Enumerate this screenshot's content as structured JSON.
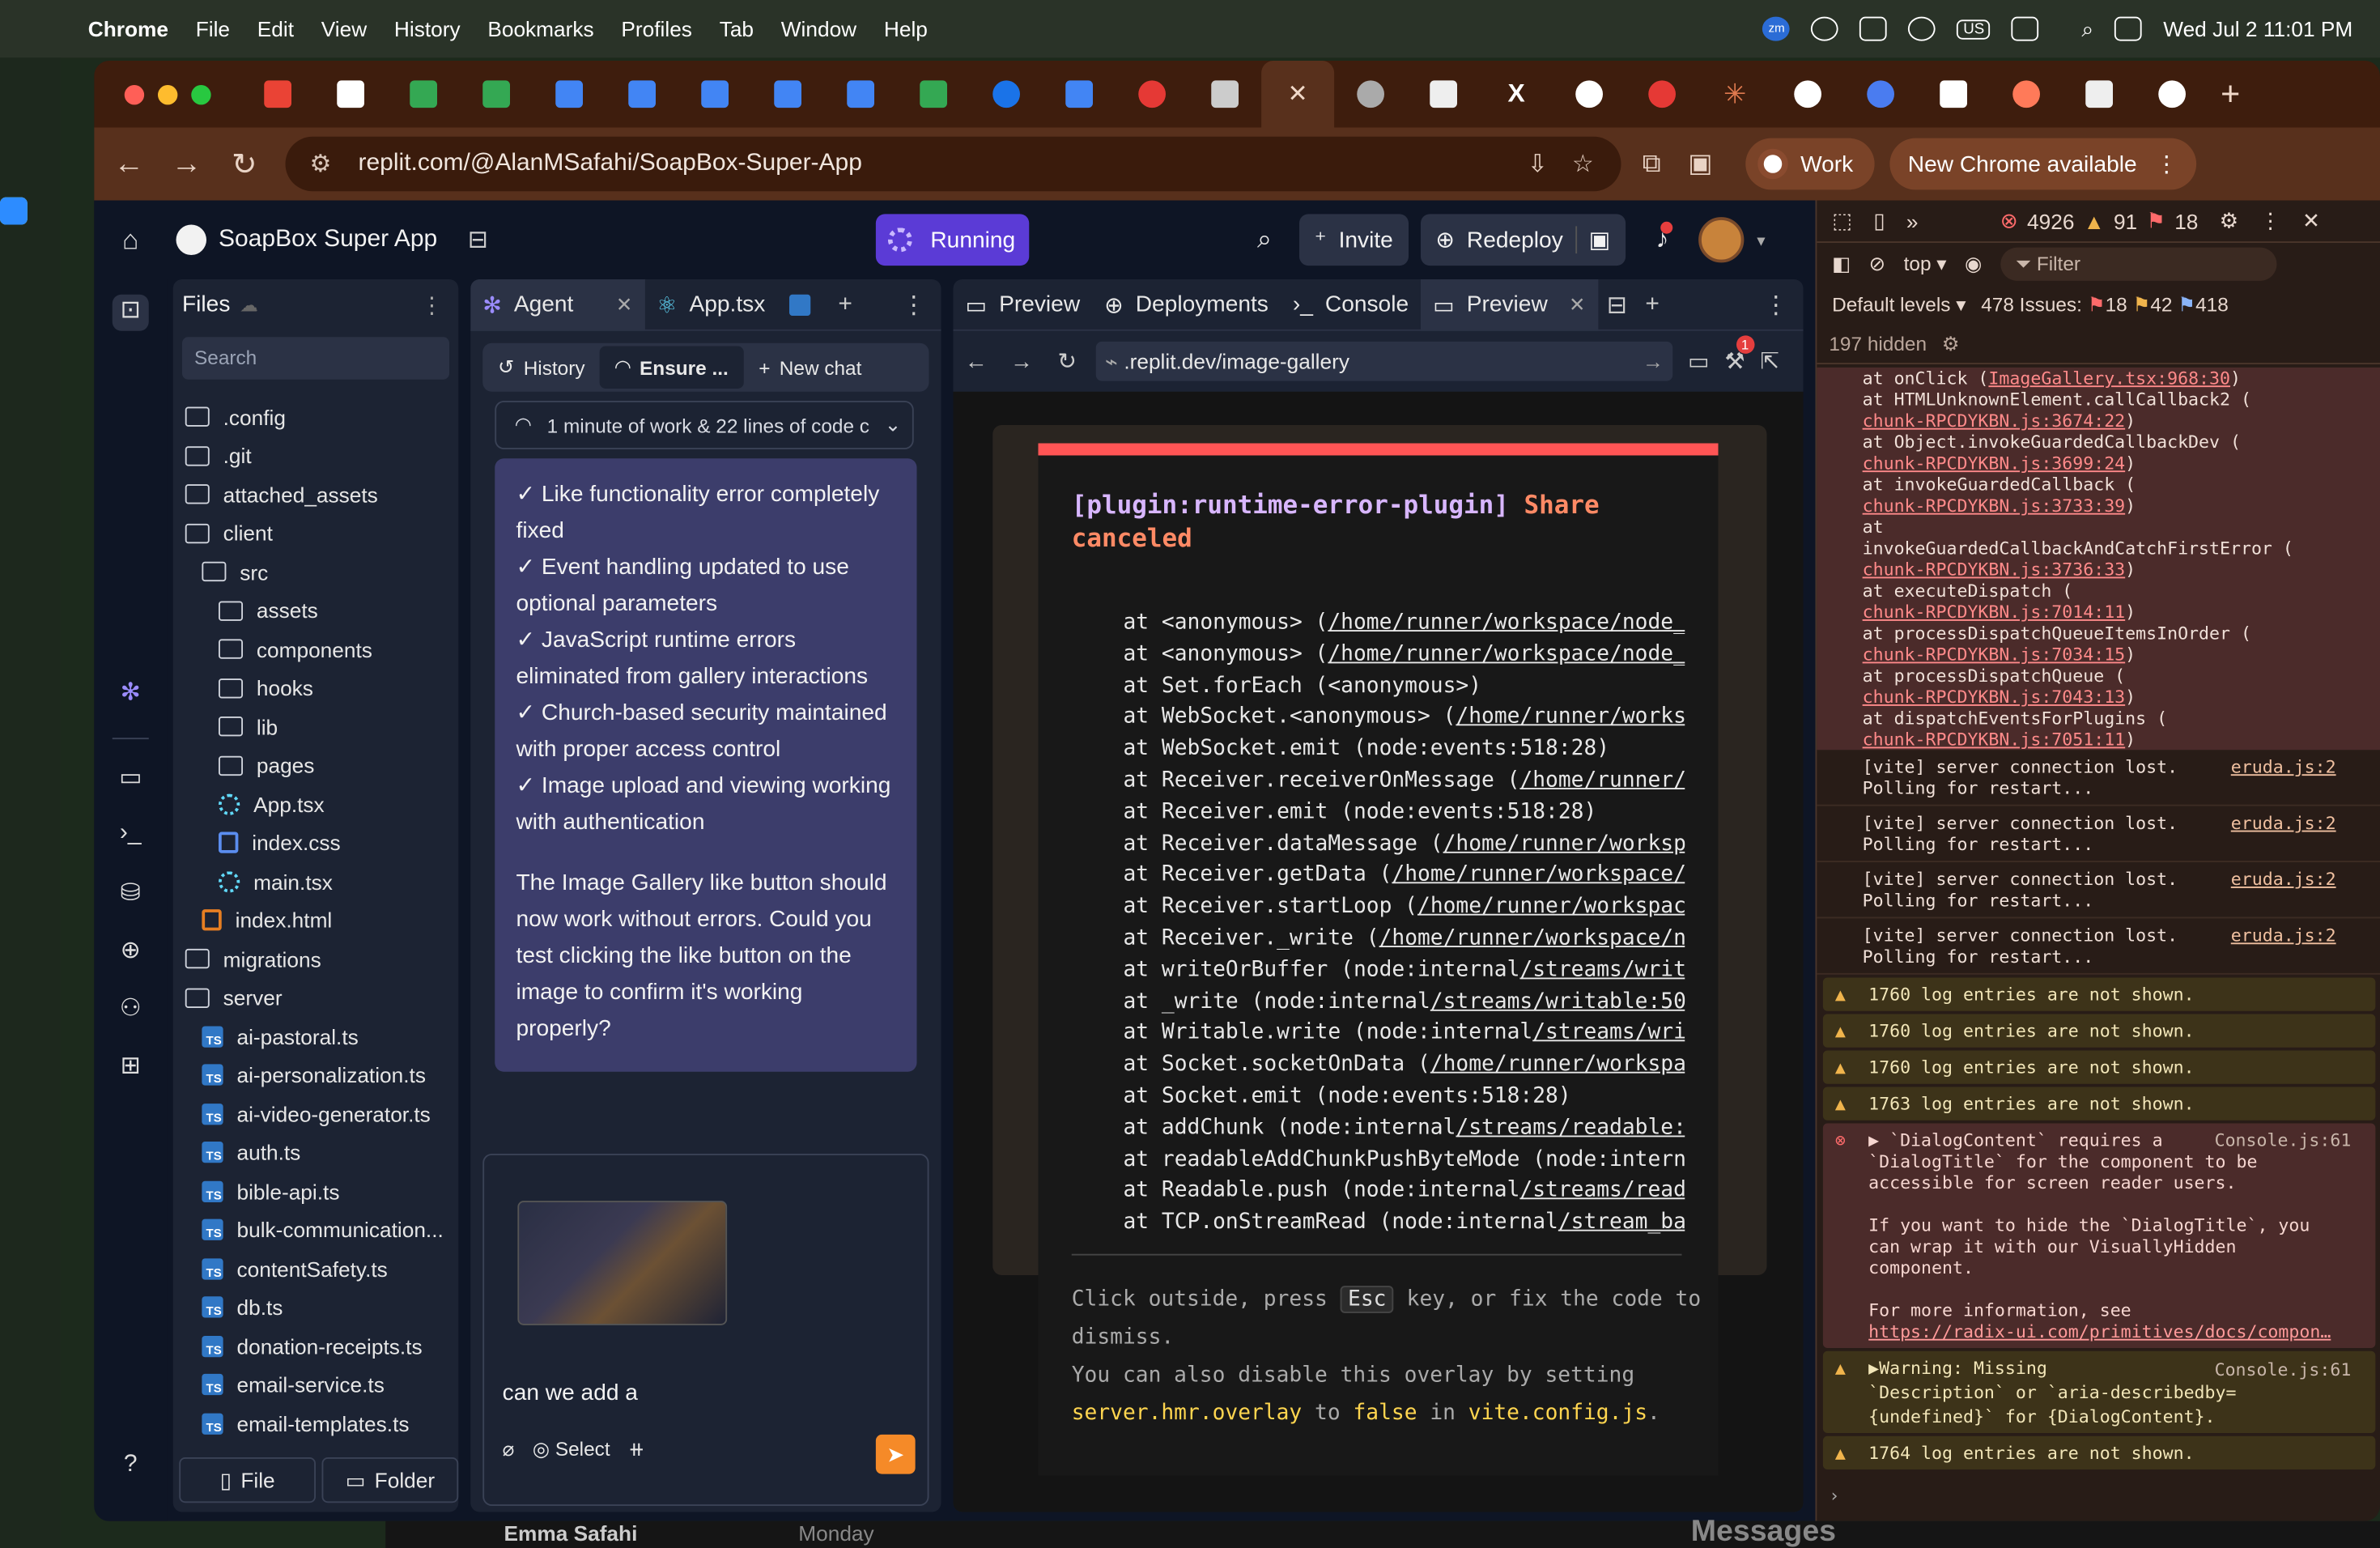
{
  "menubar": {
    "app": "Chrome",
    "items": [
      "File",
      "Edit",
      "View",
      "History",
      "Bookmarks",
      "Profiles",
      "Tab",
      "Window",
      "Help"
    ],
    "status": {
      "keyboard": "US",
      "datetime": "Wed Jul 2  11:01 PM",
      "zoom_icon_label": "zm"
    }
  },
  "browser": {
    "url": "replit.com/@AlanMSafahi/SoapBox-Super-App",
    "profile_label": "Work",
    "update_label": "New Chrome available"
  },
  "replit": {
    "project_name": "SoapBox Super App",
    "run_status": "Running",
    "invite_label": "Invite",
    "redeploy_label": "Redeploy"
  },
  "files": {
    "title": "Files",
    "search_placeholder": "Search",
    "tree": [
      {
        "name": ".config",
        "type": "folder",
        "depth": 0
      },
      {
        "name": ".git",
        "type": "folder",
        "depth": 0
      },
      {
        "name": "attached_assets",
        "type": "folder",
        "depth": 0
      },
      {
        "name": "client",
        "type": "folder",
        "depth": 0
      },
      {
        "name": "src",
        "type": "folder",
        "depth": 1
      },
      {
        "name": "assets",
        "type": "folder",
        "depth": 2
      },
      {
        "name": "components",
        "type": "folder",
        "depth": 2
      },
      {
        "name": "hooks",
        "type": "folder",
        "depth": 2
      },
      {
        "name": "lib",
        "type": "folder",
        "depth": 2
      },
      {
        "name": "pages",
        "type": "folder",
        "depth": 2
      },
      {
        "name": "App.tsx",
        "type": "react",
        "depth": 2
      },
      {
        "name": "index.css",
        "type": "css",
        "depth": 2
      },
      {
        "name": "main.tsx",
        "type": "react",
        "depth": 2
      },
      {
        "name": "index.html",
        "type": "html",
        "depth": 1
      },
      {
        "name": "migrations",
        "type": "folder",
        "depth": 0
      },
      {
        "name": "server",
        "type": "folder",
        "depth": 0
      },
      {
        "name": "ai-pastoral.ts",
        "type": "ts",
        "depth": 1
      },
      {
        "name": "ai-personalization.ts",
        "type": "ts",
        "depth": 1
      },
      {
        "name": "ai-video-generator.ts",
        "type": "ts",
        "depth": 1
      },
      {
        "name": "auth.ts",
        "type": "ts",
        "depth": 1
      },
      {
        "name": "bible-api.ts",
        "type": "ts",
        "depth": 1
      },
      {
        "name": "bulk-communication...",
        "type": "ts",
        "depth": 1
      },
      {
        "name": "contentSafety.ts",
        "type": "ts",
        "depth": 1
      },
      {
        "name": "db.ts",
        "type": "ts",
        "depth": 1
      },
      {
        "name": "donation-receipts.ts",
        "type": "ts",
        "depth": 1
      },
      {
        "name": "email-service.ts",
        "type": "ts",
        "depth": 1
      },
      {
        "name": "email-templates.ts",
        "type": "ts",
        "depth": 1
      }
    ],
    "new_file_label": "File",
    "new_folder_label": "Folder"
  },
  "agent": {
    "tabs": [
      "Agent",
      "App.tsx"
    ],
    "history_label": "History",
    "ensure_label": "Ensure ...",
    "new_chat_label": "New chat",
    "work_summary": "1 minute of work & 22 lines of code c",
    "message_checks": [
      "✓ Like functionality error completely fixed",
      "✓ Event handling updated to use optional parameters",
      "✓ JavaScript runtime errors eliminated from gallery interactions",
      "✓ Church-based security maintained with proper access control",
      "✓ Image upload and viewing working with authentication"
    ],
    "message_followup": "The Image Gallery like button should now work without errors. Could you test clicking the like button on the image to confirm it's working properly?",
    "input_text": "can we add a",
    "select_label": "Select"
  },
  "preview": {
    "tabs": [
      "Preview",
      "Deployments",
      "Console",
      "Preview"
    ],
    "url": ".replit.dev/image-gallery",
    "notification_count": "1",
    "error": {
      "plugin": "[plugin:runtime-error-plugin]",
      "message": "Share canceled",
      "stack": [
        {
          "pre": "at <anonymous> (",
          "link": "/home/runner/workspace/node_m"
        },
        {
          "pre": "at <anonymous> (",
          "link": "/home/runner/workspace/node_m"
        },
        {
          "pre": "at Set.forEach (<anonymous>)",
          "link": ""
        },
        {
          "pre": "at WebSocket.<anonymous> (",
          "link": "/home/runner/works"
        },
        {
          "pre": "at WebSocket.emit (node:events:518:28)",
          "link": ""
        },
        {
          "pre": "at Receiver.receiverOnMessage (",
          "link": "/home/runner/w"
        },
        {
          "pre": "at Receiver.emit (node:events:518:28)",
          "link": ""
        },
        {
          "pre": "at Receiver.dataMessage (",
          "link": "/home/runner/worksp"
        },
        {
          "pre": "at Receiver.getData (",
          "link": "/home/runner/workspace/"
        },
        {
          "pre": "at Receiver.startLoop (",
          "link": "/home/runner/workspac"
        },
        {
          "pre": "at Receiver._write (",
          "link": "/home/runner/workspace/n"
        },
        {
          "pre": "at writeOrBuffer (node:internal",
          "link": "/streams/writa"
        },
        {
          "pre": "at _write (node:internal",
          "link": "/streams/writable:50"
        },
        {
          "pre": "at Writable.write (node:internal",
          "link": "/streams/wri"
        },
        {
          "pre": "at Socket.socketOnData (",
          "link": "/home/runner/workspa"
        },
        {
          "pre": "at Socket.emit (node:events:518:28)",
          "link": ""
        },
        {
          "pre": "at addChunk (node:internal",
          "link": "/streams/readable:5"
        },
        {
          "pre": "at readableAddChunkPushByteMode (node:intern",
          "link": ""
        },
        {
          "pre": "at Readable.push (node:internal",
          "link": "/streams/reada"
        },
        {
          "pre": "at TCP.onStreamRead (node:internal",
          "link": "/stream_ba"
        }
      ],
      "tip_1": "Click outside, press",
      "tip_key": "Esc",
      "tip_2": "key, or fix the code to dismiss.",
      "tip_3": "You can also disable this overlay by setting",
      "tip_code_1": "server.hmr.overlay",
      "tip_4": "to",
      "tip_code_2": "false",
      "tip_5": "in",
      "tip_code_3": "vite.config.js",
      "tip_6": "."
    }
  },
  "devtools": {
    "errors": "4926",
    "warnings": "91",
    "issues_badge": "18",
    "context": "top",
    "filter_placeholder": "Filter",
    "levels": "Default levels",
    "issues_label": "478 Issues:",
    "issues_err": "18",
    "issues_warn": "42",
    "issues_info": "418",
    "hidden": "197 hidden",
    "stack_lines": [
      {
        "text": "at onClick (",
        "link": "ImageGallery.tsx:968:30",
        "end": ")"
      },
      {
        "text": "at HTMLUnknownElement.callCallback2 (",
        "link": "",
        "end": ""
      },
      {
        "text": "",
        "link": "chunk-RPCDYKBN.js:3674:22",
        "end": ")"
      },
      {
        "text": "at Object.invokeGuardedCallbackDev (",
        "link": "",
        "end": ""
      },
      {
        "text": "",
        "link": "chunk-RPCDYKBN.js:3699:24",
        "end": ")"
      },
      {
        "text": "at invokeGuardedCallback (",
        "link": "",
        "end": ""
      },
      {
        "text": "",
        "link": "chunk-RPCDYKBN.js:3733:39",
        "end": ")"
      },
      {
        "text": "at",
        "link": "",
        "end": ""
      },
      {
        "text": "invokeGuardedCallbackAndCatchFirstError (",
        "link": "",
        "end": ""
      },
      {
        "text": "",
        "link": "chunk-RPCDYKBN.js:3736:33",
        "end": ")"
      },
      {
        "text": "at executeDispatch (",
        "link": "",
        "end": ""
      },
      {
        "text": "",
        "link": "chunk-RPCDYKBN.js:7014:11",
        "end": ")"
      },
      {
        "text": "at processDispatchQueueItemsInOrder (",
        "link": "",
        "end": ""
      },
      {
        "text": "",
        "link": "chunk-RPCDYKBN.js:7034:15",
        "end": ")"
      },
      {
        "text": "at processDispatchQueue (",
        "link": "",
        "end": ""
      },
      {
        "text": "",
        "link": "chunk-RPCDYKBN.js:7043:13",
        "end": ")"
      },
      {
        "text": "at dispatchEventsForPlugins (",
        "link": "",
        "end": ""
      },
      {
        "text": "",
        "link": "chunk-RPCDYKBN.js:7051:11",
        "end": ")"
      }
    ],
    "vite_logs": [
      {
        "l1": "[vite] server connection lost.",
        "l2": "Polling for restart...",
        "src": "eruda.js:2"
      },
      {
        "l1": "[vite] server connection lost.",
        "l2": "Polling for restart...",
        "src": "eruda.js:2"
      },
      {
        "l1": "[vite] server connection lost.",
        "l2": "Polling for restart...",
        "src": "eruda.js:2"
      },
      {
        "l1": "[vite] server connection lost.",
        "l2": "Polling for restart...",
        "src": "eruda.js:2"
      }
    ],
    "hidden_warnings": [
      "1760 log entries are not shown.",
      "1760 log entries are not shown.",
      "1760 log entries are not shown.",
      "1763 log entries are not shown."
    ],
    "dialog_error": {
      "l1": "▶ `DialogContent` requires a",
      "src": "Console.js:61",
      "l2": "`DialogTitle` for the component to be",
      "l3": "accessible for screen reader users.",
      "l4": "If you want to hide the `DialogTitle`, you",
      "l5": "can wrap it with our VisuallyHidden",
      "l6": "component.",
      "l7": "For more information, see",
      "link": "https://radix-ui.com/primitives/docs/compon…"
    },
    "dialog_warning": {
      "l1": "▶Warning: Missing",
      "src": "Console.js:61",
      "l2": "`Description` or `aria-describedby=",
      "l3": "{undefined}` for {DialogContent}."
    },
    "last_warning": "1764 log entries are not shown."
  },
  "background": {
    "name": "Emma Safahi",
    "day": "Monday",
    "messages": "Messages"
  },
  "colors": {
    "running": "#5b3bd6",
    "agent_message_bg": "#3c3d6b",
    "error_banner": "#ff5555",
    "send_button": "#f58a28"
  }
}
